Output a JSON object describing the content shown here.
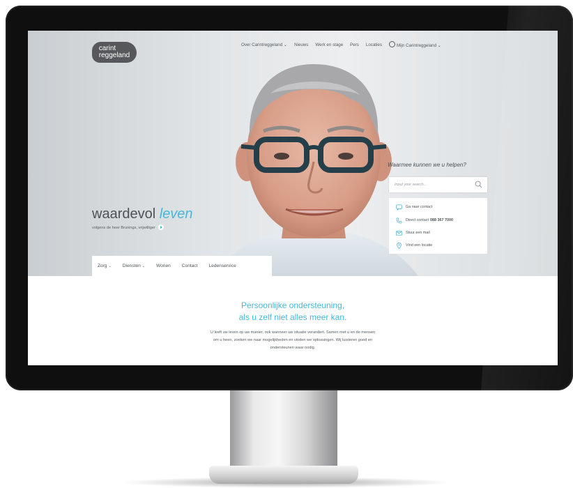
{
  "logo": {
    "line1": "carint",
    "line2": "reggeland"
  },
  "topnav": {
    "items": [
      {
        "label": "Over Carintreggeland",
        "chevron": "⌄"
      },
      {
        "label": "Nieuws"
      },
      {
        "label": "Werk en stage"
      },
      {
        "label": "Pers"
      },
      {
        "label": "Locaties"
      },
      {
        "label": "Mijn Carintreggeland",
        "chevron": "⌄",
        "icon": "globe-icon"
      }
    ]
  },
  "hero": {
    "title_plain": "waardevol",
    "title_accent": "leven",
    "subtitle": "volgens de heer Brunings, vrijwilliger"
  },
  "help": {
    "title": "Waarmee kunnen we u helpen?",
    "search_placeholder": "Input your search..."
  },
  "contact": {
    "items": [
      {
        "icon": "chat-icon",
        "label": "Ga naar contact"
      },
      {
        "icon": "phone-icon",
        "label": "Direct contact",
        "number": "088 367 7000"
      },
      {
        "icon": "mail-icon",
        "label": "Stuur een mail"
      },
      {
        "icon": "location-icon",
        "label": "Vind een locatie"
      }
    ]
  },
  "tabs": [
    {
      "label": "Zorg",
      "chevron": "⌄"
    },
    {
      "label": "Diensten",
      "chevron": "⌄"
    },
    {
      "label": "Wonen"
    },
    {
      "label": "Contact"
    },
    {
      "label": "Ledenservice"
    }
  ],
  "content": {
    "heading_line1": "Persoonlijke ondersteuning,",
    "heading_line2": "als u zelf niet alles meer kan.",
    "body_line1": "U leeft uw leven op uw manier, ook wanneer uw situatie verandert. Samen met u en de mensen",
    "body_line2": "om u heen, zoeken we naar mogelijkheden en vinden we oplossingen. Wij luisteren goed en",
    "body_line3": "ondersteunen waar nodig."
  },
  "colors": {
    "accent": "#46b7d8",
    "text": "#4d5358",
    "logo": "#56585b"
  }
}
